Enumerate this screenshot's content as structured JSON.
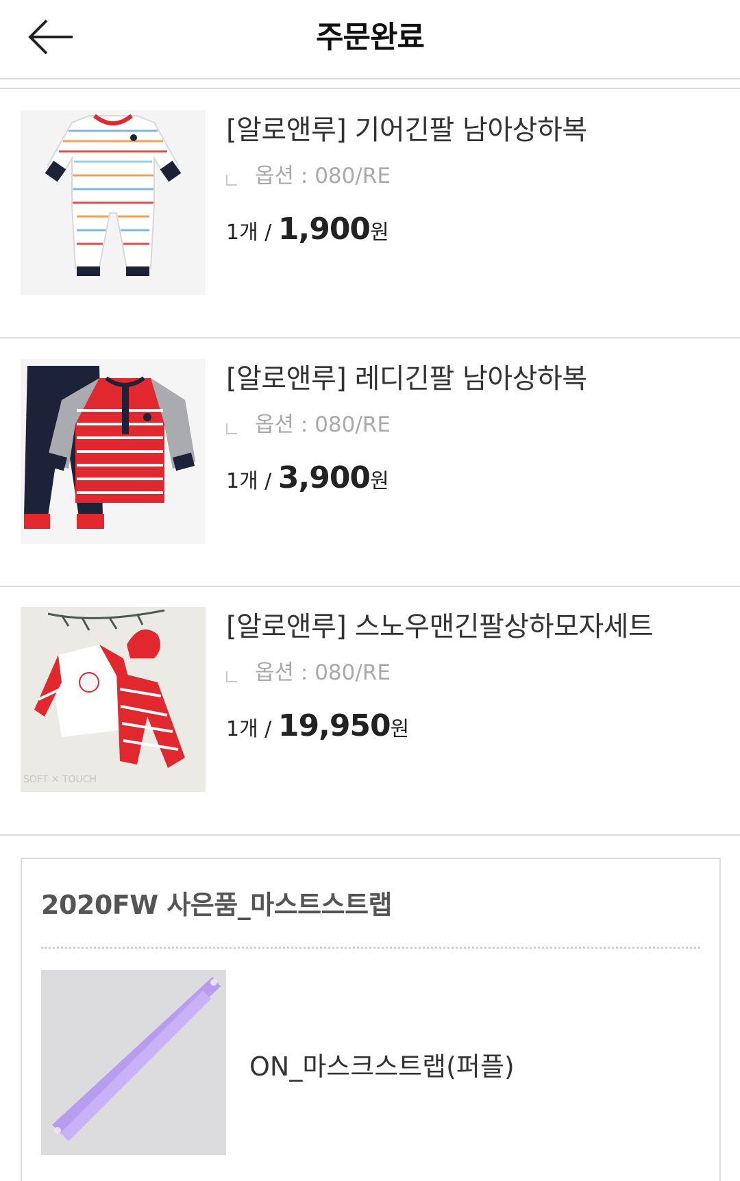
{
  "header": {
    "title": "주문완료",
    "back_icon": "arrow-left-icon"
  },
  "products": [
    {
      "title": "[알로앤루] 기어긴팔 남아상하복",
      "option": "옵션 : 080/RE",
      "qty": "1개 / ",
      "price": "1,900",
      "currency": "원"
    },
    {
      "title": "[알로앤루] 레디긴팔 남아상하복",
      "option": "옵션 : 080/RE",
      "qty": "1개 / ",
      "price": "3,900",
      "currency": "원"
    },
    {
      "title": "[알로앤루] 스노우맨긴팔상하모자세트",
      "option": "옵션 : 080/RE",
      "qty": "1개 / ",
      "price": "19,950",
      "currency": "원"
    }
  ],
  "gift": {
    "title": "2020FW 사은품_마스트스트랩",
    "item_name": "ON_마스크스트랩(퍼플)"
  },
  "colors": {
    "accent_red": "#e0282e",
    "navy": "#1c2238",
    "purple": "#b79cf0",
    "divider": "#dcdcdc"
  }
}
